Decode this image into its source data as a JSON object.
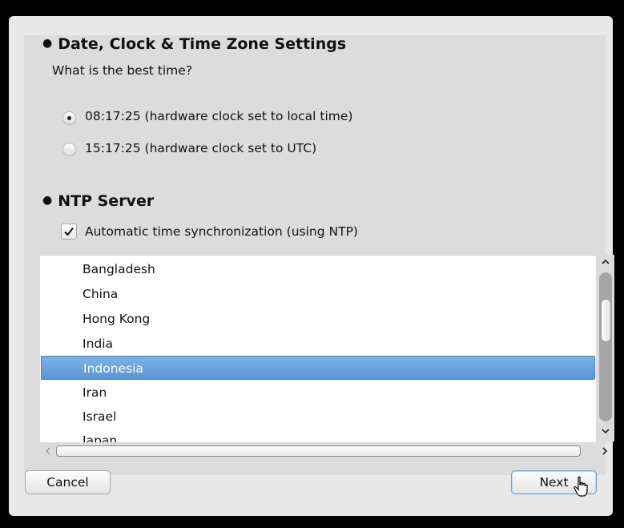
{
  "section_time": {
    "heading": "Date, Clock & Time Zone Settings",
    "question": "What is the best time?",
    "options": [
      {
        "label": "08:17:25 (hardware clock set to local time)",
        "selected": true
      },
      {
        "label": "15:17:25 (hardware clock set to UTC)",
        "selected": false
      }
    ]
  },
  "section_ntp": {
    "heading": "NTP Server",
    "auto_sync_label": "Automatic time synchronization (using NTP)",
    "auto_sync_checked": true,
    "countries": [
      "Bangladesh",
      "China",
      "Hong Kong",
      "India",
      "Indonesia",
      "Iran",
      "Israel",
      "Japan"
    ],
    "selected_country": "Indonesia"
  },
  "buttons": {
    "cancel": "Cancel",
    "next": "Next"
  },
  "colors": {
    "selection": "#5b95d5",
    "dialog_bg": "#e8e8e8"
  },
  "icons": {
    "scroll_up": "chevron-up-icon",
    "scroll_down": "chevron-down-icon",
    "scroll_left": "chevron-left-icon",
    "scroll_right": "chevron-right-icon",
    "cursor": "mouse-pointer-icon"
  }
}
